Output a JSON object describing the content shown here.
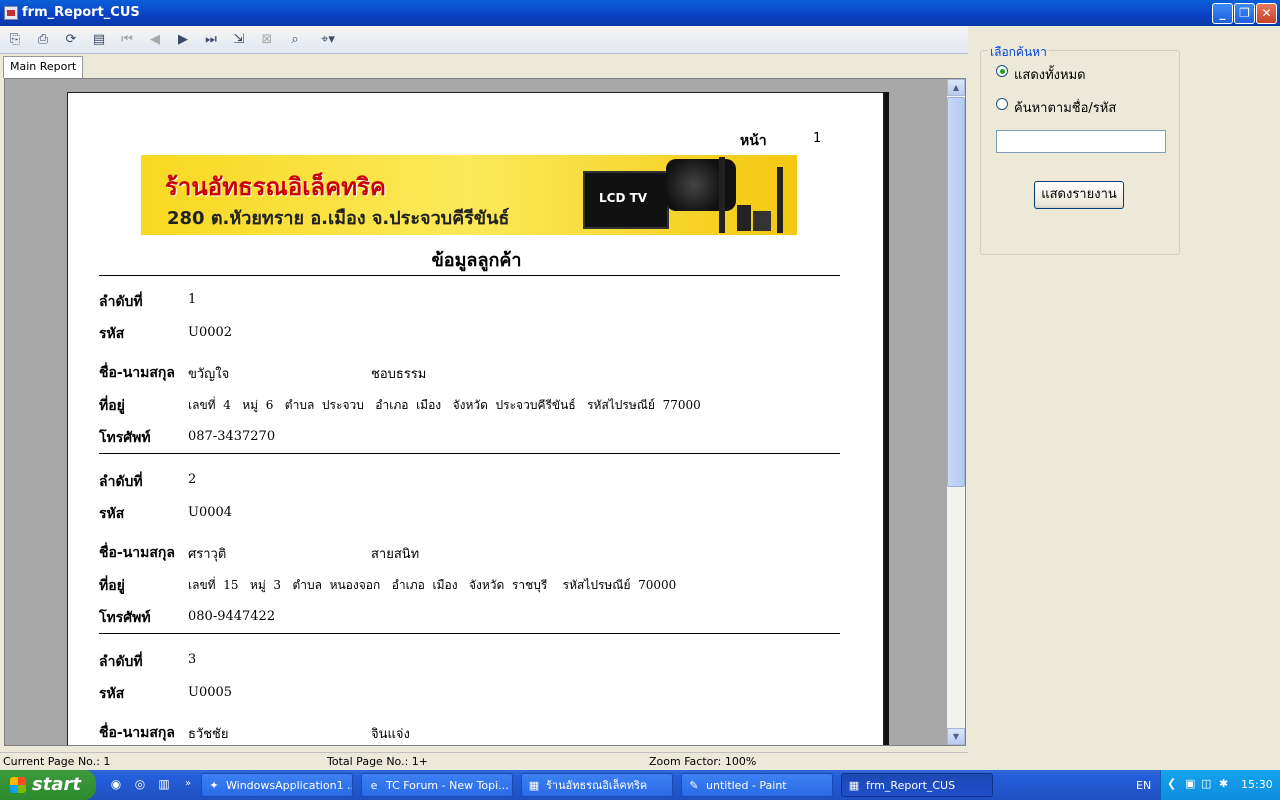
{
  "window": {
    "title": "frm_Report_CUS"
  },
  "toolbar": {
    "icons": [
      "export-icon",
      "print-icon",
      "refresh-icon",
      "group-tree-icon",
      "first-page-icon",
      "prev-page-icon",
      "next-page-icon",
      "last-page-icon",
      "goto-page-icon",
      "stop-icon",
      "search-binoculars-icon",
      "zoom-icon"
    ]
  },
  "tabs": {
    "main": "Main Report"
  },
  "report": {
    "page_label": "หน้า",
    "page_number": "1",
    "banner_shop": "ร้านอัทธรณอิเล็คทริค",
    "banner_address": "280 ต.หัวยทราย อ.เมือง จ.ประจวบคีรีขันธ์",
    "banner_tv": "LCD TV",
    "title": "ข้อมูลลูกค้า",
    "labels": {
      "seq": "ลำดับที่",
      "code": "รหัส",
      "name": "ชื่อ-นามสกุล",
      "address": "ที่อยู่",
      "phone": "โทรศัพท์"
    },
    "customers": [
      {
        "seq": "1",
        "code": "U0002",
        "first": "ขวัญใจ",
        "last": "ชอบธรรม",
        "address": "เลขที่  4   หมู่  6   ตำบล  ประจวบ   อำเภอ  เมือง   จังหวัด  ประจวบคีรีขันธ์   รหัสไปรษณีย์  77000",
        "phone": "087-3437270"
      },
      {
        "seq": "2",
        "code": "U0004",
        "first": "ศราวุติ",
        "last": "สายสนิท",
        "address": "เลขที่  15   หมู่  3   ตำบล  หนองจอก   อำเภอ  เมือง   จังหวัด  ราชบุรี    รหัสไปรษณีย์  70000",
        "phone": "080-9447422"
      },
      {
        "seq": "3",
        "code": "U0005",
        "first": "ธวัชชัย",
        "last": "จินแจ่ง"
      }
    ]
  },
  "status": {
    "current": "Current Page No.: 1",
    "total": "Total Page No.: 1+",
    "zoom": "Zoom Factor: 100%"
  },
  "search_panel": {
    "legend": "เลือกค้นหา",
    "option_all": "แสดงทั้งหมด",
    "option_search": "ค้นหาตามชื่อ/รหัส",
    "search_value": "",
    "button": "แสดงรายงาน"
  },
  "taskbar": {
    "start": "start",
    "tasks": [
      "WindowsApplication1 ...",
      "TC Forum - New Topi...",
      "ร้านอัทธรณอิเล็คทริค",
      "untitled - Paint",
      "frm_Report_CUS"
    ],
    "language": "EN",
    "clock": "15:30"
  }
}
